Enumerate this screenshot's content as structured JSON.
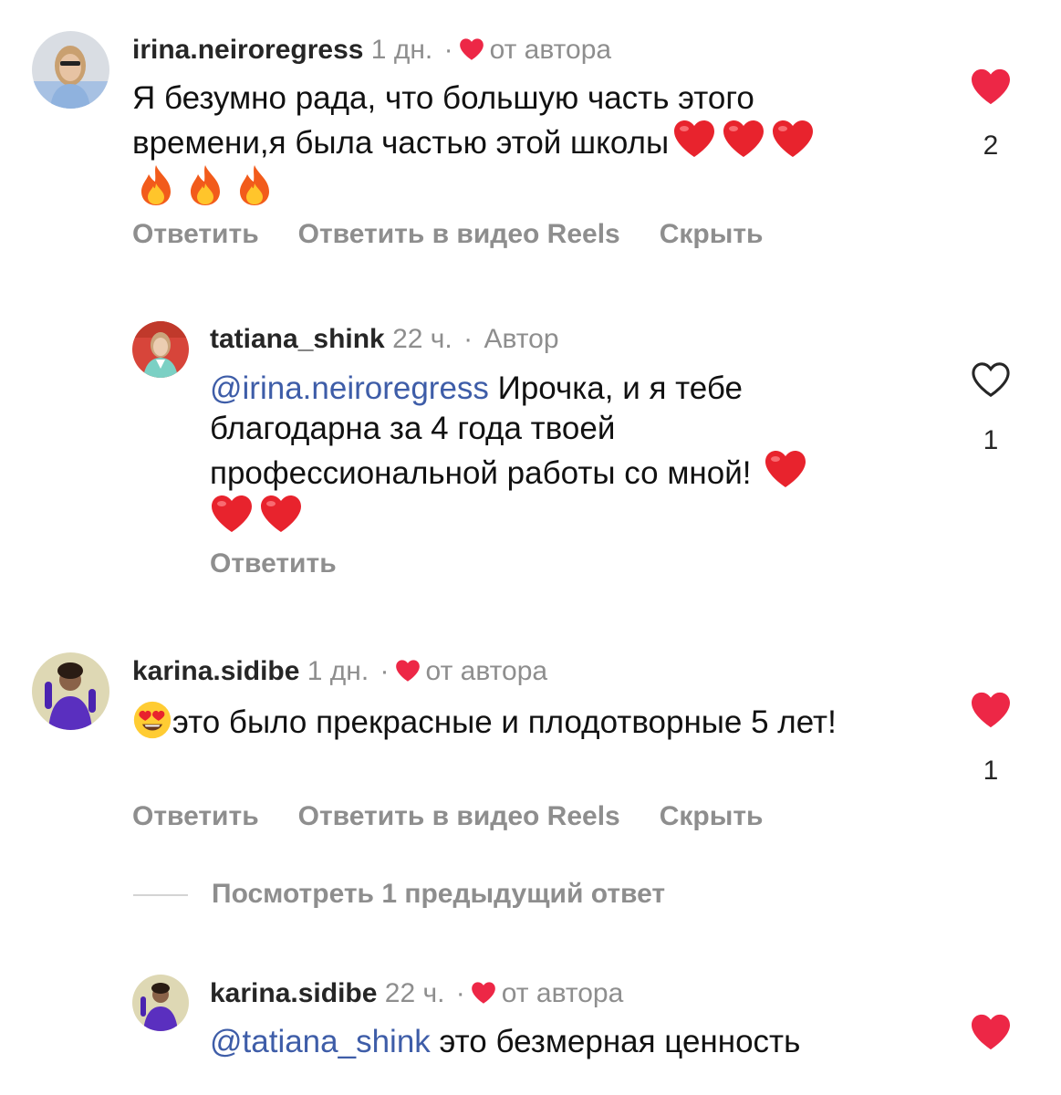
{
  "colors": {
    "like_red": "#ed2746",
    "mention_blue": "#3e5da8",
    "muted_gray": "#8e8e8e"
  },
  "comments": [
    {
      "username": "irina.neiroregress",
      "time": "1 дн.",
      "sep": "·",
      "tag": "от автора",
      "text": "Я безумно рада, что большую часть этого времени,я была частью этой школы",
      "emojis": [
        "heart",
        "heart",
        "heart",
        "fire",
        "fire",
        "fire"
      ],
      "likes": "2",
      "liked": true,
      "actions": [
        "Ответить",
        "Ответить в видео Reels",
        "Скрыть"
      ]
    },
    {
      "username": "tatiana_shink",
      "time": "22 ч.",
      "sep": "·",
      "tag": "Автор",
      "mention": "@irina.neiroregress",
      "text": "Ирочка, и я тебе благодарна за 4 года твоей профессиональной работы со мной!",
      "emojis": [
        "heart",
        "heart",
        "heart"
      ],
      "likes": "1",
      "liked": false,
      "actions": [
        "Ответить"
      ]
    },
    {
      "username": "karina.sidibe",
      "time": "1 дн.",
      "sep": "·",
      "tag": "от автора",
      "text": "это было прекрасные и плодотворные 5 лет!",
      "emojis": [
        "heart-eyes"
      ],
      "likes": "1",
      "liked": true,
      "actions": [
        "Ответить",
        "Ответить в видео Reels",
        "Скрыть"
      ]
    },
    {
      "username": "karina.sidibe",
      "time": "22 ч.",
      "sep": "·",
      "tag": "от автора",
      "mention": "@tatiana_shink",
      "text": "это безмерная ценность",
      "liked": true
    }
  ],
  "view_previous": "Посмотреть 1 предыдущий ответ"
}
